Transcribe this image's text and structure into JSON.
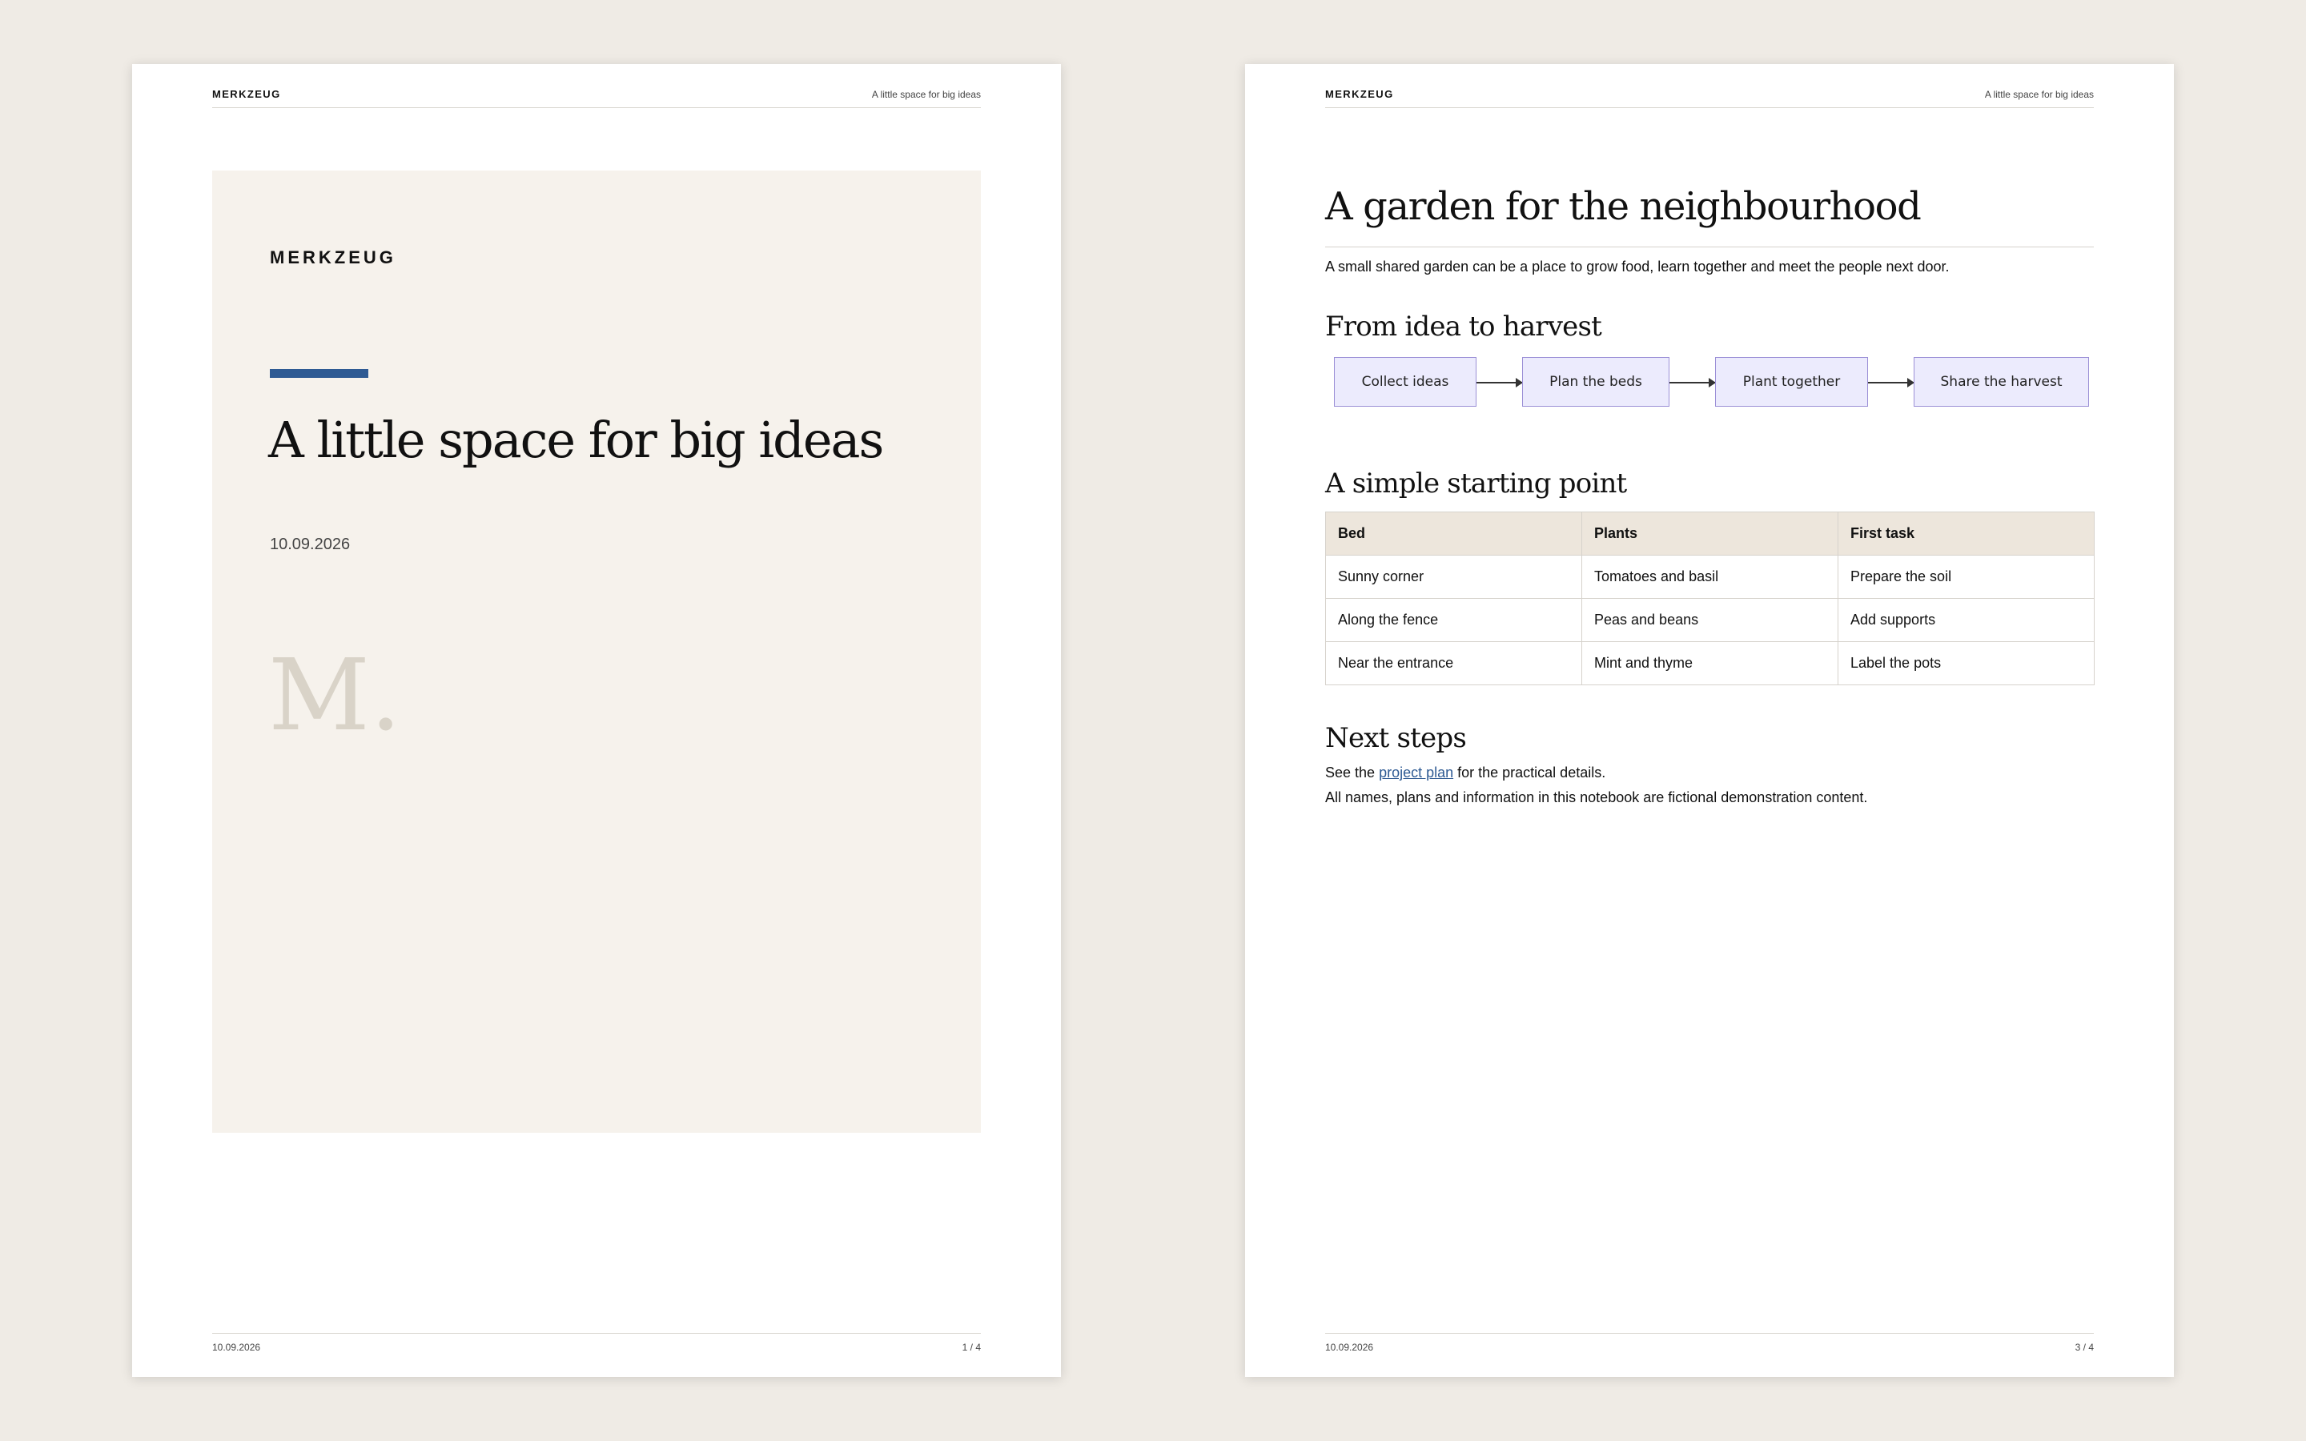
{
  "header": {
    "brand": "MERKZEUG",
    "tagline": "A little space for big ideas"
  },
  "cover": {
    "brand": "MERKZEUG",
    "title": "A little space for big ideas",
    "date": "10.09.2026",
    "monogram": "M.",
    "accent_color": "#2e5a93"
  },
  "left_footer": {
    "date": "10.09.2026",
    "page": "1 / 4"
  },
  "doc": {
    "title": "A garden for the neighbourhood",
    "intro": "A small shared garden can be a place to grow food, learn together and meet the people next door.",
    "flow_heading": "From idea to harvest",
    "flow_steps": [
      "Collect ideas",
      "Plan the beds",
      "Plant together",
      "Share the harvest"
    ],
    "table_heading": "A simple starting point",
    "table": {
      "columns": [
        "Bed",
        "Plants",
        "First task"
      ],
      "rows": [
        [
          "Sunny corner",
          "Tomatoes and basil",
          "Prepare the soil"
        ],
        [
          "Along the fence",
          "Peas and beans",
          "Add supports"
        ],
        [
          "Near the entrance",
          "Mint and thyme",
          "Label the pots"
        ]
      ]
    },
    "next_heading": "Next steps",
    "next_prefix": "See the ",
    "next_link": "project plan",
    "next_suffix": " for the practical details.",
    "disclaimer": "All names, plans and information in this notebook are fictional demonstration content."
  },
  "right_footer": {
    "date": "10.09.2026",
    "page": "3 / 4"
  }
}
